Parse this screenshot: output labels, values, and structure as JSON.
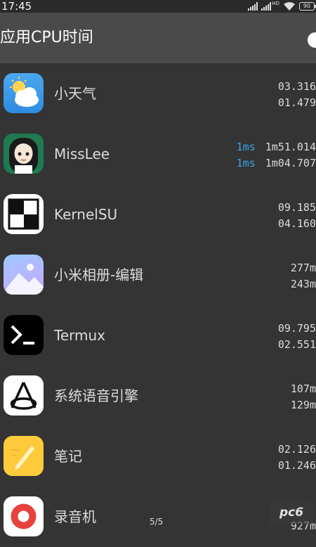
{
  "status_bar": {
    "time": "17:45",
    "network_label": "HD",
    "battery": "90"
  },
  "header": {
    "title": "应用CPU时间"
  },
  "apps": [
    {
      "name": "小天气",
      "icon": "weather-icon",
      "extra": "",
      "time1": "03.316",
      "time2": "01.479"
    },
    {
      "name": "MissLee",
      "icon": "girl-avatar-icon",
      "extra": "1ms",
      "extra2": "1ms",
      "time1": "1m51.014",
      "time2": "1m04.707"
    },
    {
      "name": "KernelSU",
      "icon": "checker-icon",
      "extra": "",
      "time1": "09.185",
      "time2": "04.160"
    },
    {
      "name": "小米相册-编辑",
      "icon": "gallery-icon",
      "extra": "",
      "time1": "277m",
      "time2": "243m"
    },
    {
      "name": "Termux",
      "icon": "terminal-icon",
      "extra": "",
      "time1": "09.795",
      "time2": "02.551"
    },
    {
      "name": "系统语音引擎",
      "icon": "voice-engine-icon",
      "extra": "",
      "time1": "107m",
      "time2": "129m"
    },
    {
      "name": "笔记",
      "icon": "notes-icon",
      "extra": "",
      "time1": "02.126",
      "time2": "01.246"
    },
    {
      "name": "录音机",
      "icon": "recorder-icon",
      "extra": "",
      "time1": "",
      "time2": "927m"
    }
  ],
  "page_indicator": "5/5",
  "watermark": "pc6",
  "colors": {
    "background": "#343434",
    "header": "#4a4a4a",
    "accent_blue": "#3ba2e8"
  }
}
